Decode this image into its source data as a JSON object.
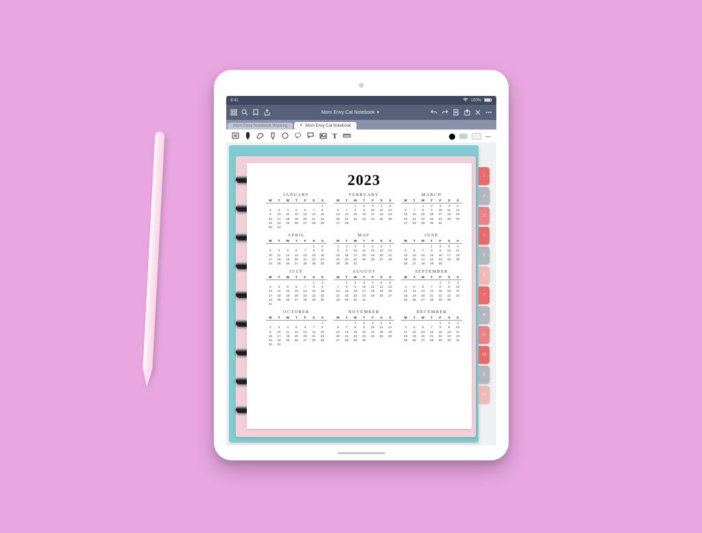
{
  "status": {
    "time": "9:41",
    "battery": "100%",
    "wifi": "wifi-icon"
  },
  "appnav": {
    "icons_left": [
      "grid-icon",
      "search-icon",
      "bookmark-icon",
      "share-icon"
    ],
    "title": "Mom Envy Cat Notebook",
    "icons_right": [
      "undo-icon",
      "redo-icon",
      "add-page-icon",
      "export-icon",
      "close-icon",
      "more-icon"
    ]
  },
  "tabs": [
    {
      "label": "Mom Envy Notebook Working",
      "active": false
    },
    {
      "label": "Mom Envy Cat Notebook",
      "active": true
    }
  ],
  "toolbar": {
    "tools": [
      "read-icon",
      "pen-icon",
      "eraser-icon",
      "highlighter-icon",
      "shape-icon",
      "lasso-icon",
      "comment-icon",
      "image-icon",
      "text-icon",
      "ruler-icon"
    ],
    "swatches": [
      "#000000",
      "#c9cfd8",
      "#eef0f2"
    ],
    "stroke_label": "—"
  },
  "sidetabs": [
    {
      "label": "1",
      "color": "#e86a6a"
    },
    {
      "label": "2",
      "color": "#b2b7bf"
    },
    {
      "label": "3",
      "color": "#e98284"
    },
    {
      "label": "4",
      "color": "#e86a6a"
    },
    {
      "label": "5",
      "color": "#b2b7bf"
    },
    {
      "label": "6",
      "color": "#f0b9b6"
    },
    {
      "label": "7",
      "color": "#e86a6a"
    },
    {
      "label": "8",
      "color": "#b2b7bf"
    },
    {
      "label": "9",
      "color": "#e98284"
    },
    {
      "label": "10",
      "color": "#e86a6a"
    },
    {
      "label": "11",
      "color": "#b2b7bf"
    },
    {
      "label": "12",
      "color": "#f0b9b6"
    }
  ],
  "calendar": {
    "year": "2023",
    "dow": [
      "M",
      "T",
      "W",
      "T",
      "F",
      "S",
      "S"
    ],
    "months": [
      "JANUARY",
      "FEBRUARY",
      "MARCH",
      "APRIL",
      "MAY",
      "JUNE",
      "JULY",
      "AUGUST",
      "SEPTEMBER",
      "OCTOBER",
      "NOVEMBER",
      "DECEMBER"
    ],
    "start_mon": [
      6,
      2,
      2,
      5,
      0,
      3,
      5,
      1,
      4,
      6,
      2,
      4
    ],
    "days": [
      31,
      28,
      31,
      30,
      31,
      30,
      31,
      31,
      30,
      31,
      30,
      31
    ]
  }
}
